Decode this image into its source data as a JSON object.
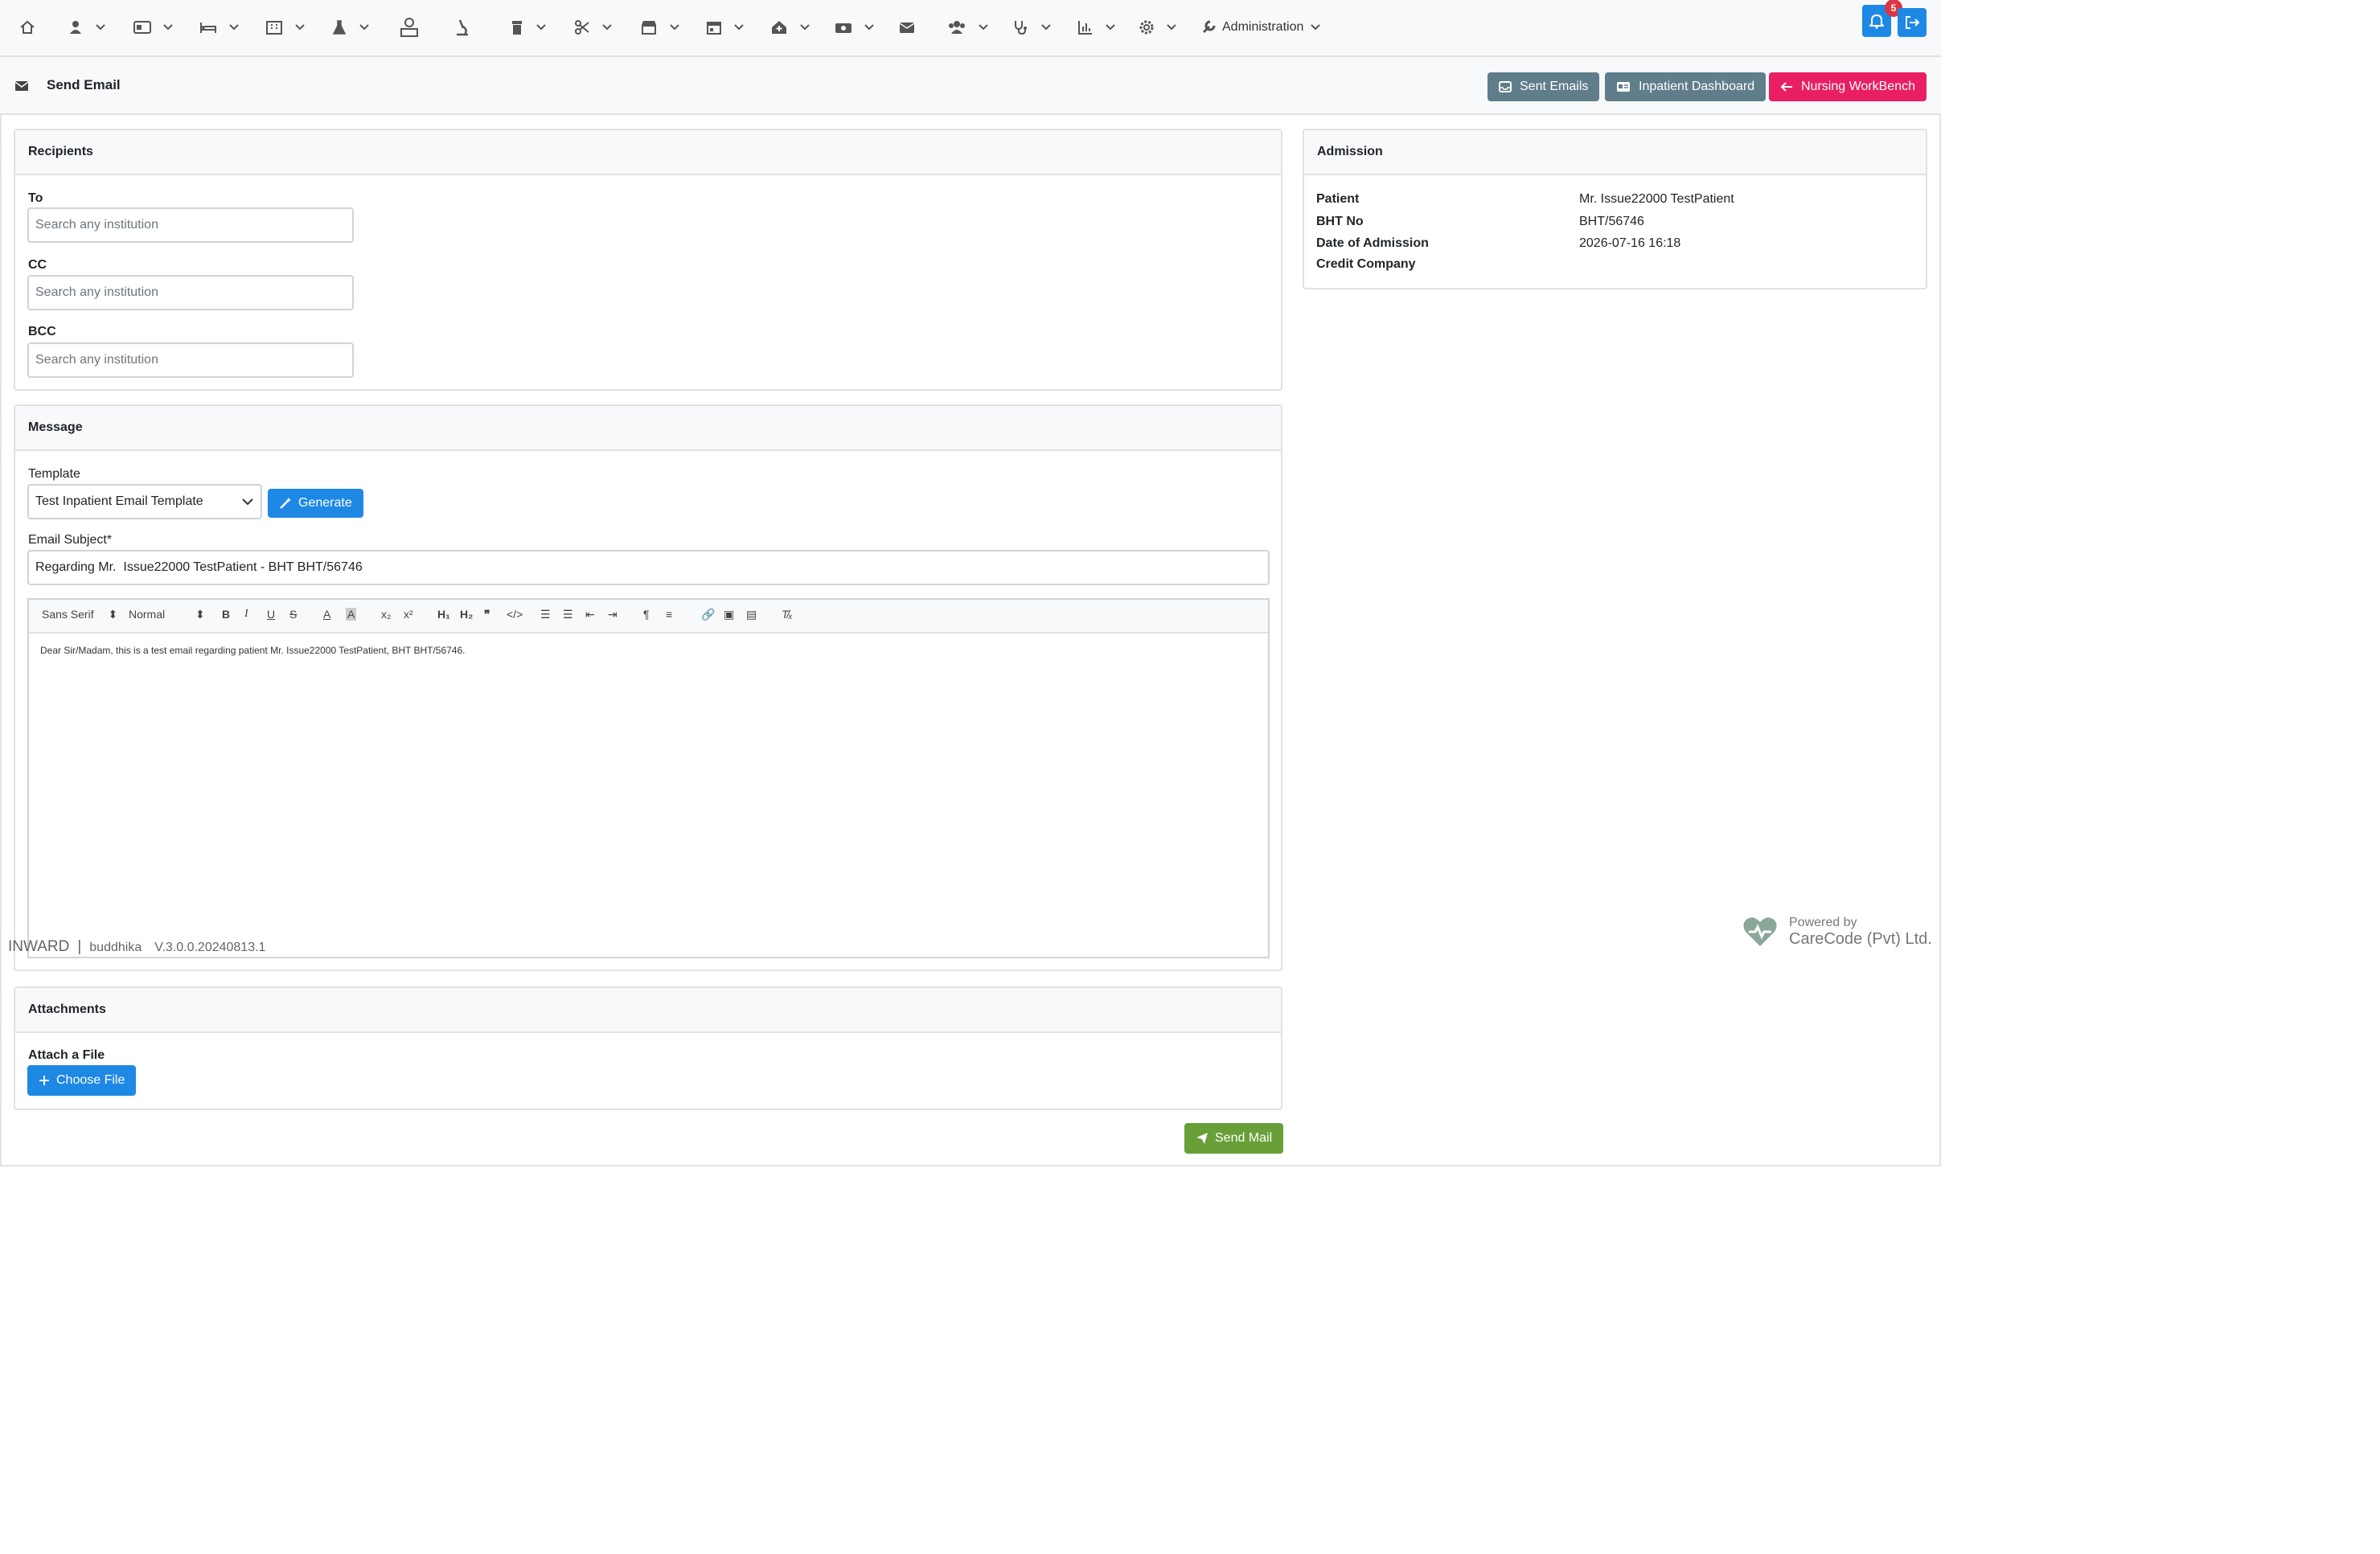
{
  "navbar": {
    "admin_label": "Administration",
    "notification_count": "5"
  },
  "header": {
    "title": "Send Email",
    "sent_emails": "Sent Emails",
    "inpatient_dashboard": "Inpatient Dashboard",
    "nursing_workbench": "Nursing WorkBench"
  },
  "recipients": {
    "title": "Recipients",
    "to_label": "To",
    "cc_label": "CC",
    "bcc_label": "BCC",
    "placeholder": "Search any institution"
  },
  "admission": {
    "title": "Admission",
    "rows": [
      {
        "label": "Patient",
        "value": "Mr. Issue22000 TestPatient"
      },
      {
        "label": "BHT No",
        "value": "BHT/56746"
      },
      {
        "label": "Date of Admission",
        "value": "2026-07-16 16:18"
      },
      {
        "label": "Credit Company",
        "value": ""
      }
    ]
  },
  "message": {
    "title": "Message",
    "template_label": "Template",
    "template_value": "Test Inpatient Email Template",
    "generate": "Generate",
    "subject_label": "Email Subject*",
    "subject_value": "Regarding Mr.  Issue22000 TestPatient - BHT BHT/56746",
    "font_select": "Sans Serif",
    "size_select": "Normal",
    "body": "Dear Sir/Madam, this is a test email regarding patient Mr. Issue22000 TestPatient, BHT BHT/56746."
  },
  "attachments": {
    "title": "Attachments",
    "attach_label": "Attach a File",
    "choose_file": "Choose File"
  },
  "send_mail": "Send Mail",
  "footer": {
    "module": "INWARD",
    "user": "buddhika",
    "version": "V.3.0.0.20240813.1",
    "powered_by": "Powered by",
    "company": "CareCode (Pvt) Ltd."
  },
  "colors": {
    "primary": "#1e88e5",
    "secondary": "#607d8b",
    "pink": "#e91e63",
    "success": "#689f38"
  }
}
